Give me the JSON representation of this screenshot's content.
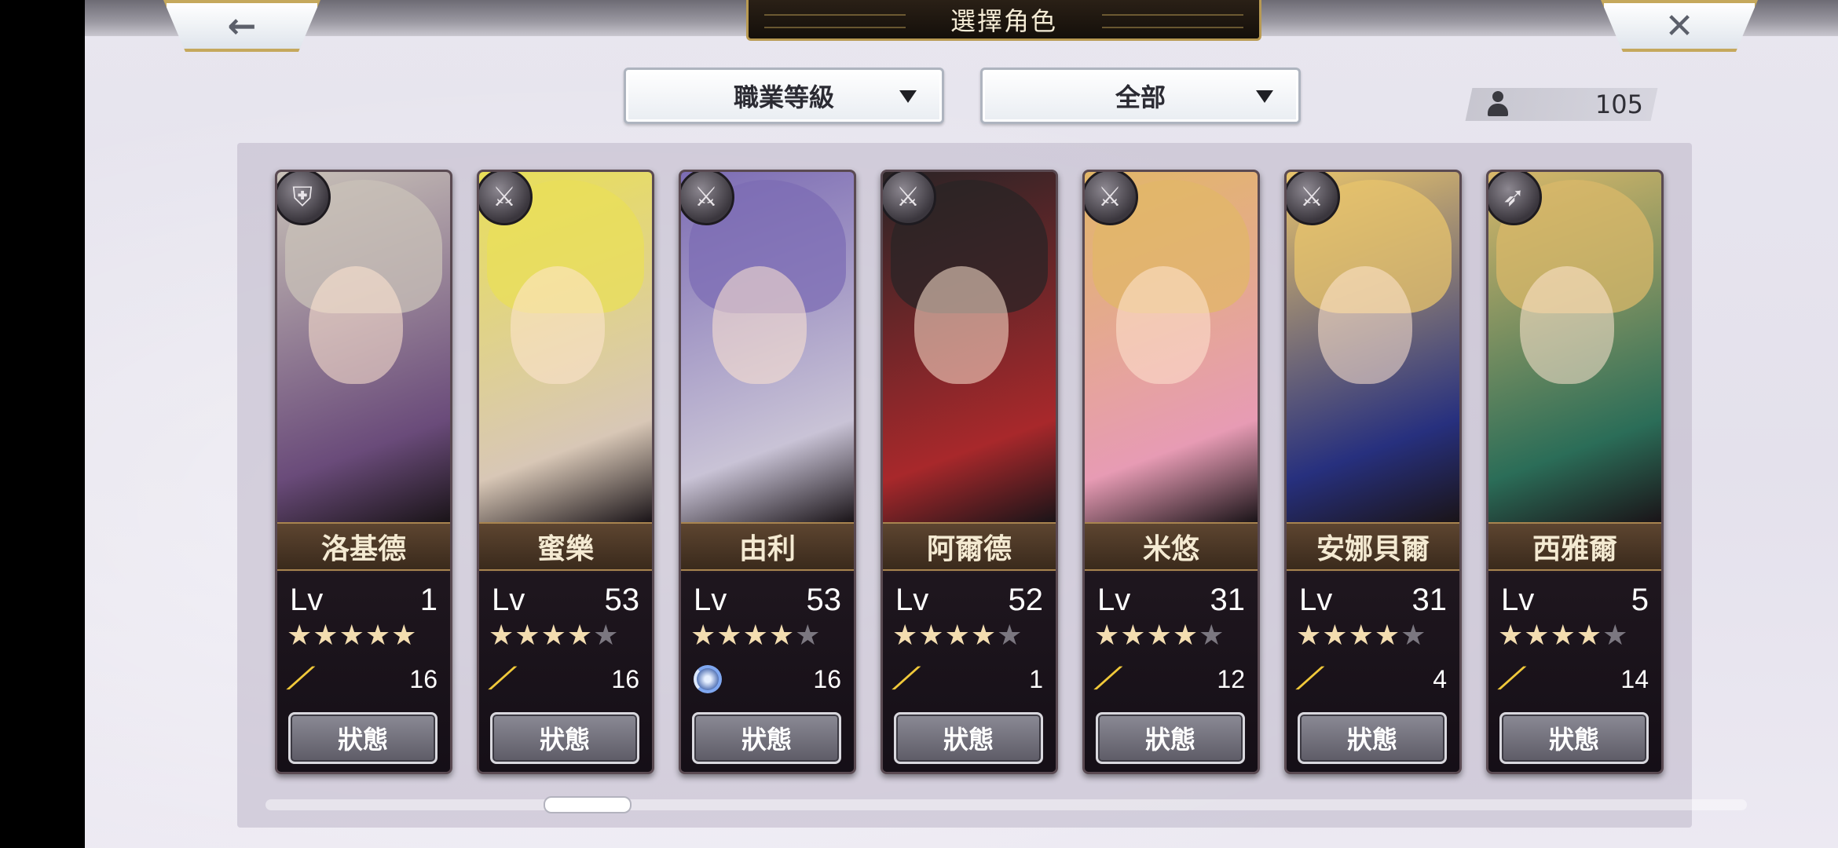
{
  "header": {
    "title": "選擇角色",
    "back_icon": "←",
    "close_icon": "✕"
  },
  "filters": {
    "class_dropdown": "職業等級",
    "type_dropdown": "全部"
  },
  "roster": {
    "count": "105"
  },
  "colors": {
    "name_bar": "#5d4530",
    "star_on": "#f3ddb0",
    "star_off": "#7b7780",
    "wing": "#f1c93a"
  },
  "characters": [
    {
      "name": "洛基德",
      "lv_label": "Lv",
      "level": "1",
      "stars": 5,
      "max_stars": 5,
      "awaken_icon": "wing-icon",
      "awaken": "16",
      "status_label": "狀態",
      "class_icon": "armor-icon",
      "palette": [
        "#c9c2b8",
        "#6a4b7a"
      ]
    },
    {
      "name": "蜜樂",
      "lv_label": "Lv",
      "level": "53",
      "stars": 4,
      "max_stars": 5,
      "awaken_icon": "wing-icon",
      "awaken": "16",
      "status_label": "狀態",
      "class_icon": "sword-icon",
      "palette": [
        "#e9df58",
        "#d8c7b6"
      ]
    },
    {
      "name": "由利",
      "lv_label": "Lv",
      "level": "53",
      "stars": 4,
      "max_stars": 5,
      "awaken_icon": "orb-icon",
      "awaken": "16",
      "status_label": "狀態",
      "class_icon": "katana-icon",
      "palette": [
        "#7c6cb4",
        "#c9c3d6"
      ]
    },
    {
      "name": "阿爾德",
      "lv_label": "Lv",
      "level": "52",
      "stars": 4,
      "max_stars": 5,
      "awaken_icon": "wing-icon",
      "awaken": "1",
      "status_label": "狀態",
      "class_icon": "sword-icon",
      "palette": [
        "#2a2426",
        "#a8282b"
      ]
    },
    {
      "name": "米悠",
      "lv_label": "Lv",
      "level": "31",
      "stars": 4,
      "max_stars": 5,
      "awaken_icon": "wing-icon",
      "awaken": "12",
      "status_label": "狀態",
      "class_icon": "sword-icon",
      "palette": [
        "#e2b768",
        "#e79bb4"
      ]
    },
    {
      "name": "安娜貝爾",
      "lv_label": "Lv",
      "level": "31",
      "stars": 4,
      "max_stars": 5,
      "awaken_icon": "wing-icon",
      "awaken": "4",
      "status_label": "狀態",
      "class_icon": "sword-icon",
      "palette": [
        "#e8c46c",
        "#27307e"
      ]
    },
    {
      "name": "西雅爾",
      "lv_label": "Lv",
      "level": "5",
      "stars": 4,
      "max_stars": 5,
      "awaken_icon": "wing-icon",
      "awaken": "14",
      "status_label": "狀態",
      "class_icon": "bow-icon",
      "palette": [
        "#d9b86a",
        "#2b6d58"
      ]
    }
  ]
}
